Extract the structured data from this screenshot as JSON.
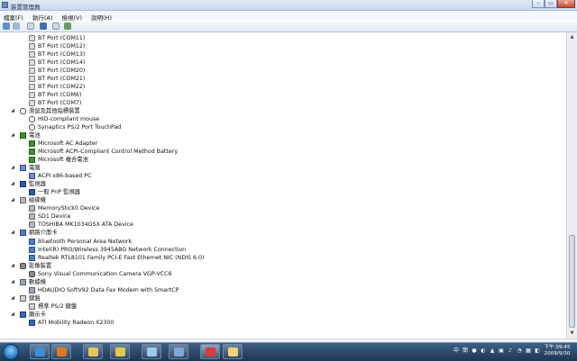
{
  "window": {
    "title": "裝置管理員"
  },
  "menu": [
    "檔案(F)",
    "執行(A)",
    "檢視(V)",
    "說明(H)"
  ],
  "tree": [
    {
      "level": 2,
      "icon": "port-icon",
      "label": "BT Port (COM11)",
      "exp": ""
    },
    {
      "level": 2,
      "icon": "port-icon",
      "label": "BT Port (COM12)",
      "exp": ""
    },
    {
      "level": 2,
      "icon": "port-icon",
      "label": "BT Port (COM13)",
      "exp": ""
    },
    {
      "level": 2,
      "icon": "port-icon",
      "label": "BT Port (COM14)",
      "exp": ""
    },
    {
      "level": 2,
      "icon": "port-icon",
      "label": "BT Port (COM20)",
      "exp": ""
    },
    {
      "level": 2,
      "icon": "port-icon",
      "label": "BT Port (COM21)",
      "exp": ""
    },
    {
      "level": 2,
      "icon": "port-icon",
      "label": "BT Port (COM22)",
      "exp": ""
    },
    {
      "level": 2,
      "icon": "port-icon",
      "label": "BT Port (COM6)",
      "exp": ""
    },
    {
      "level": 2,
      "icon": "port-icon",
      "label": "BT Port (COM7)",
      "exp": ""
    },
    {
      "level": 1,
      "icon": "mouse-icon",
      "label": "滑鼠及其他指標裝置",
      "exp": "◢"
    },
    {
      "level": 2,
      "icon": "mouse-icon",
      "label": "HID-compliant mouse",
      "exp": ""
    },
    {
      "level": 2,
      "icon": "mouse-icon",
      "label": "Synaptics PS/2 Port TouchPad",
      "exp": ""
    },
    {
      "level": 1,
      "icon": "battery-icon",
      "label": "電池",
      "exp": "◢"
    },
    {
      "level": 2,
      "icon": "battery-icon",
      "label": "Microsoft AC Adapter",
      "exp": ""
    },
    {
      "level": 2,
      "icon": "battery-icon",
      "label": "Microsoft ACPI-Compliant Control Method Battery",
      "exp": ""
    },
    {
      "level": 2,
      "icon": "battery-icon",
      "label": "Microsoft 複合電池",
      "exp": ""
    },
    {
      "level": 1,
      "icon": "computer-icon",
      "label": "電腦",
      "exp": "◢"
    },
    {
      "level": 2,
      "icon": "computer-icon",
      "label": "ACPI x86-based PC",
      "exp": ""
    },
    {
      "level": 1,
      "icon": "monitor-icon",
      "label": "監視器",
      "exp": "◢"
    },
    {
      "level": 2,
      "icon": "monitor-icon",
      "label": "一般 PnP 監視器",
      "exp": ""
    },
    {
      "level": 1,
      "icon": "disk-icon",
      "label": "磁碟機",
      "exp": "◢"
    },
    {
      "level": 2,
      "icon": "disk-icon",
      "label": "MemoryStick0 Device",
      "exp": ""
    },
    {
      "level": 2,
      "icon": "disk-icon",
      "label": "SD1 Device",
      "exp": ""
    },
    {
      "level": 2,
      "icon": "disk-icon",
      "label": "TOSHIBA MK1034GSX ATA Device",
      "exp": ""
    },
    {
      "level": 1,
      "icon": "network-icon",
      "label": "網路介面卡",
      "exp": "◢"
    },
    {
      "level": 2,
      "icon": "network-icon",
      "label": "Bluetooth Personal Area Network",
      "exp": ""
    },
    {
      "level": 2,
      "icon": "network-icon",
      "label": "Intel(R) PRO/Wireless 3945ABG Network Connection",
      "exp": ""
    },
    {
      "level": 2,
      "icon": "network-icon",
      "label": "Realtek RTL8101 Family PCI-E Fast Ethernet NIC (NDIS 6.0)",
      "exp": ""
    },
    {
      "level": 1,
      "icon": "camera-icon",
      "label": "影像裝置",
      "exp": "◢"
    },
    {
      "level": 2,
      "icon": "camera-icon",
      "label": "Sony Visual Communication Camera VGP-VCC6",
      "exp": ""
    },
    {
      "level": 1,
      "icon": "modem-icon",
      "label": "數據機",
      "exp": "◢"
    },
    {
      "level": 2,
      "icon": "modem-icon",
      "label": "HDAUDIO SoftV92 Data Fax Modem with SmartCP",
      "exp": ""
    },
    {
      "level": 1,
      "icon": "keyboard-icon",
      "label": "鍵盤",
      "exp": "◢"
    },
    {
      "level": 2,
      "icon": "keyboard-icon",
      "label": "標準 PS/2 鍵盤",
      "exp": ""
    },
    {
      "level": 1,
      "icon": "display-icon",
      "label": "顯示卡",
      "exp": "◢"
    },
    {
      "level": 2,
      "icon": "display-icon",
      "label": "ATI Mobility Radeon X2300",
      "exp": ""
    }
  ],
  "taskbar": {
    "apps": [
      {
        "name": "ie-icon",
        "color": "#3a8fd8"
      },
      {
        "name": "media-player-icon",
        "color": "#e07a1f"
      },
      {
        "name": "explorer-icon",
        "color": "#e7c35a"
      },
      {
        "name": "app-icon",
        "color": "#e2c94a"
      },
      {
        "name": "window-icon",
        "color": "#9fc8ec"
      },
      {
        "name": "device-manager-icon",
        "color": "#7ea6d6"
      },
      {
        "name": "toolbox-icon",
        "color": "#d63c3c"
      },
      {
        "name": "paint-icon",
        "color": "#f0d37a"
      }
    ],
    "tray": [
      "中",
      "簡",
      "●",
      "◐",
      "▲",
      "▣",
      "♪",
      "◔",
      "▦",
      "◧"
    ],
    "time": "下午 09:45",
    "date": "2009/9/30"
  }
}
